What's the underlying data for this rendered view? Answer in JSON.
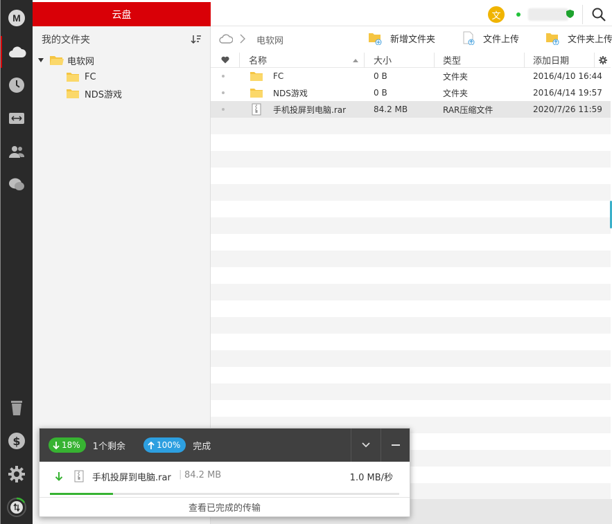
{
  "rail": {
    "logo_letter": "M",
    "items": [
      "cloud-drive",
      "recent",
      "transfers",
      "contacts",
      "chat"
    ],
    "bottom": [
      "rubbish-bin",
      "upgrade",
      "settings",
      "sync-status"
    ]
  },
  "header": {
    "title": "云盘",
    "avatar_letter": "文",
    "accent_color": "#d90007"
  },
  "left_panel": {
    "title": "我的文件夹",
    "tree": {
      "root": "电软网",
      "children": [
        "FC",
        "NDS游戏"
      ]
    }
  },
  "breadcrumb": {
    "current": "电软网"
  },
  "toolbar": {
    "new_folder": "新增文件夹",
    "file_upload": "文件上传",
    "folder_upload": "文件夹上传"
  },
  "columns": {
    "name": "名称",
    "size": "大小",
    "type": "类型",
    "date": "添加日期"
  },
  "files": [
    {
      "name": "FC",
      "size": "0 B",
      "type": "文件夹",
      "date": "2016/4/10 16:44",
      "kind": "folder"
    },
    {
      "name": "NDS游戏",
      "size": "0 B",
      "type": "文件夹",
      "date": "2016/4/14 19:57",
      "kind": "folder"
    },
    {
      "name": "手机投屏到电脑.rar",
      "size": "84.2 MB",
      "type": "RAR压缩文件",
      "date": "2020/7/26 11:59",
      "kind": "archive"
    }
  ],
  "transfer": {
    "download_pct": "18%",
    "remaining": "1个剩余",
    "upload_pct": "100%",
    "upload_status": "完成",
    "item": {
      "name": "手机投屏到电脑.rar",
      "size": "84.2 MB",
      "speed": "1.0 MB/秒",
      "progress": 0.18
    },
    "view_completed": "查看已完成的传输"
  }
}
